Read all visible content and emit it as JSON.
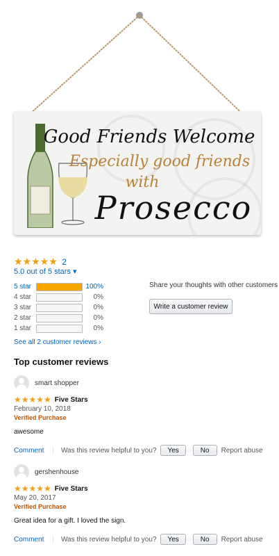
{
  "product": {
    "sign_lines": [
      "Good Friends Welcome",
      "Especially good friends",
      "with",
      "Prosecco"
    ]
  },
  "rating": {
    "stars": "★★★★★",
    "count": "2",
    "out_of": "5.0 out of 5 stars ▾",
    "histogram": [
      {
        "label": "5 star",
        "fill": 1.0,
        "pct": "100%",
        "link": true
      },
      {
        "label": "4 star",
        "fill": 0.0,
        "pct": "0%",
        "link": false
      },
      {
        "label": "3 star",
        "fill": 0.0,
        "pct": "0%",
        "link": false
      },
      {
        "label": "2 star",
        "fill": 0.0,
        "pct": "0%",
        "link": false
      },
      {
        "label": "1 star",
        "fill": 0.0,
        "pct": "0%",
        "link": false
      }
    ],
    "see_all": "See all 2 customer reviews ›"
  },
  "share": {
    "text": "Share your thoughts with other customers",
    "button": "Write a customer review"
  },
  "reviews_section": {
    "title": "Top customer reviews",
    "reviews": [
      {
        "name": "smart shopper",
        "stars": "★★★★★",
        "title": "Five Stars",
        "date": "February 10, 2018",
        "verified": "Verified Purchase",
        "body": "awesome"
      },
      {
        "name": "gershenhouse",
        "stars": "★★★★★",
        "title": "Five Stars",
        "date": "May 20, 2017",
        "verified": "Verified Purchase",
        "body": "Great idea for a gift. I loved the sign."
      }
    ],
    "actions": {
      "comment": "Comment",
      "sep": "|",
      "helpful": "Was this review helpful to you?",
      "yes": "Yes",
      "no": "No",
      "report": "Report abuse"
    }
  },
  "colors": {
    "star": "#f0a010",
    "link": "#0066c0",
    "verified": "#c45500",
    "bar_fill": "#f7a600"
  }
}
